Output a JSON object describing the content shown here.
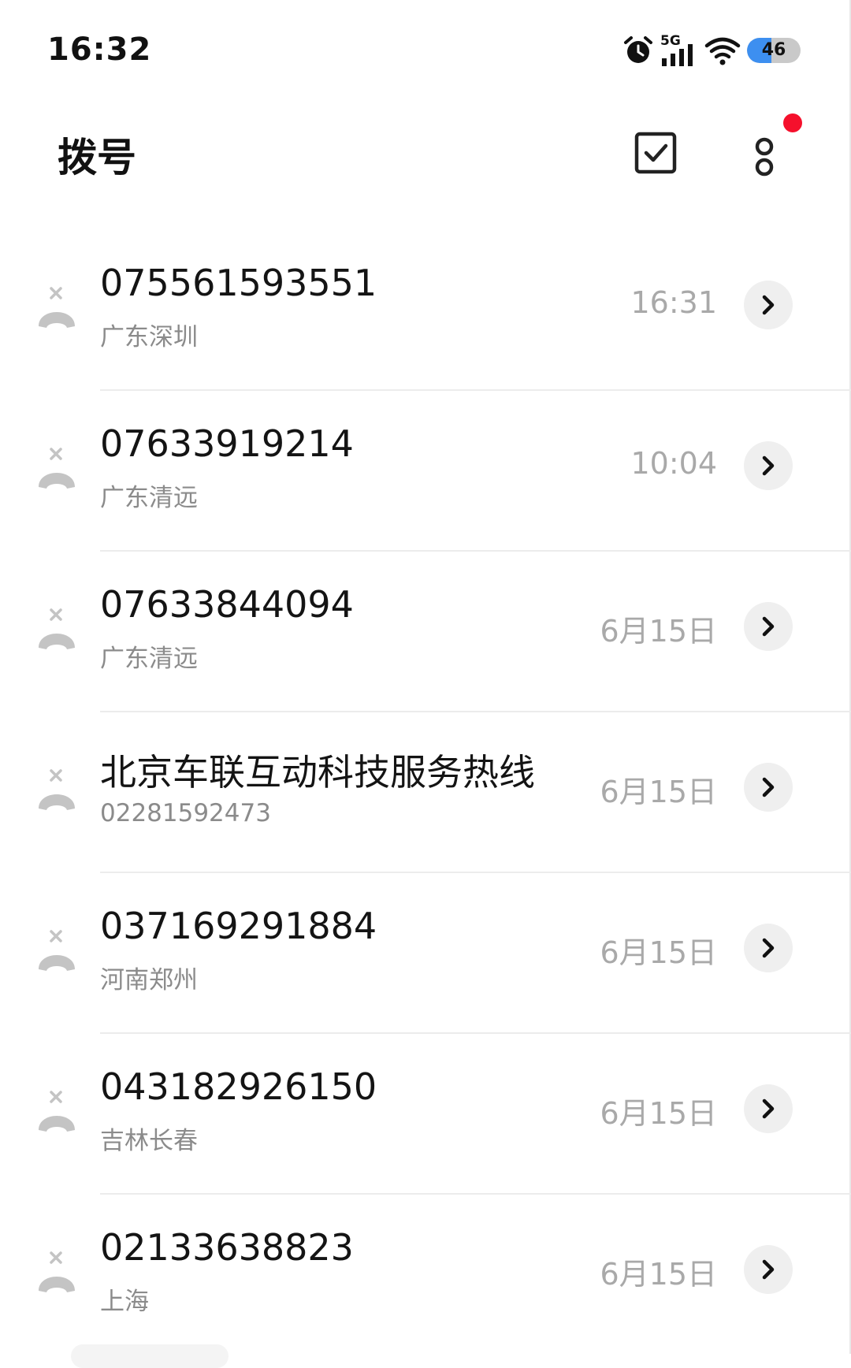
{
  "status_bar": {
    "time": "16:32",
    "network_label": "5G",
    "battery_level": "46",
    "battery_fill_percent": 46,
    "icons": [
      "alarm-icon",
      "cellular-signal-icon",
      "wifi-icon",
      "battery-icon"
    ]
  },
  "header": {
    "title": "拨号",
    "icons": [
      "multi-select-checkbox-icon",
      "more-options-icon"
    ],
    "notification_dot_color": "#f5102c"
  },
  "calls": [
    {
      "name": "075561593551",
      "subtitle": "广东深圳",
      "time": "16:31"
    },
    {
      "name": "07633919214",
      "subtitle": "广东清远",
      "time": "10:04"
    },
    {
      "name": "07633844094",
      "subtitle": "广东清远",
      "time": "6月15日"
    },
    {
      "name": "北京车联互动科技服务热线",
      "subtitle": "02281592473",
      "time": "6月15日"
    },
    {
      "name": "037169291884",
      "subtitle": "河南郑州",
      "time": "6月15日"
    },
    {
      "name": "043182926150",
      "subtitle": "吉林长春",
      "time": "6月15日"
    },
    {
      "name": "02133638823",
      "subtitle": "上海",
      "time": "6月15日"
    }
  ],
  "colors": {
    "accent_battery": "#3d8ff0",
    "notification": "#f5102c",
    "missed_call_icon": "#c4c4c4",
    "secondary_text": "#8b8b8b"
  }
}
